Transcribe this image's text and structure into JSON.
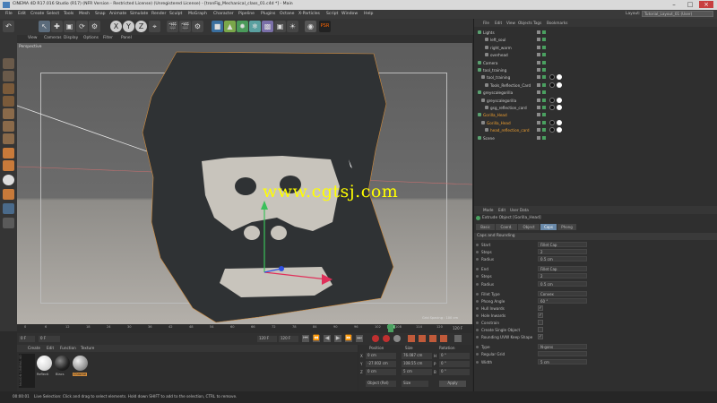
{
  "title": "CINEMA 4D R17.016 Studio (R17) (NFR Version - Restricted License) (Unregistered License) - [tronFig_Mechanical_class_01.c4d *] - Main",
  "menu": [
    "File",
    "Edit",
    "Create",
    "Select",
    "Tools",
    "Mesh",
    "Snap",
    "Animate",
    "Simulate",
    "Render",
    "Sculpt",
    "MoGraph",
    "Character",
    "Pipeline",
    "Plugins",
    "Octane",
    "X-Particles",
    "Script",
    "Window",
    "Help"
  ],
  "layout": {
    "label": "Layout:",
    "value": "Tutorial_Layout_01 (User)"
  },
  "toolbar": {
    "xyz": [
      "X",
      "Y",
      "Z"
    ],
    "tooltip": "Render Settings"
  },
  "viewport": {
    "menu": [
      "View",
      "Cameras",
      "Display",
      "Options",
      "Filter",
      "Panel"
    ],
    "label": "Perspective",
    "watermark": "www.cgtsj.com",
    "grid_spacing": "Grid Spacing : 100 cm"
  },
  "timeline": {
    "ticks": [
      "0",
      "6",
      "12",
      "18",
      "24",
      "30",
      "36",
      "42",
      "48",
      "54",
      "60",
      "66",
      "72",
      "78",
      "84",
      "90",
      "96",
      "102",
      "108",
      "114",
      "120"
    ],
    "current": "104",
    "current_right": "120 F",
    "start": "0 F",
    "frame": "0 F",
    "end": "120 F",
    "end2": "120 F"
  },
  "materials": {
    "menu": [
      "Create",
      "Edit",
      "Function",
      "Texture"
    ],
    "items": [
      "Reflecti",
      "Blacs",
      "Chrome"
    ],
    "brand": "MAXON CINEMA 4D"
  },
  "coords": {
    "headers": [
      "Position",
      "Size",
      "Rotation"
    ],
    "rows": [
      {
        "axis": "X",
        "pos": "0 cm",
        "size": "76.087 cm",
        "rot_axis": "H",
        "rot": "0 °"
      },
      {
        "axis": "Y",
        "pos": "-27.002 cm",
        "size": "108.55 cm",
        "rot_axis": "P",
        "rot": "0 °"
      },
      {
        "axis": "Z",
        "pos": "0 cm",
        "size": "5 cm",
        "rot_axis": "B",
        "rot": "0 °"
      }
    ],
    "mode1": "Object (Rel)",
    "mode2": "Size",
    "apply": "Apply"
  },
  "status": {
    "time": "00:00:01",
    "text": "Live Selection: Click and drag to select elements. Hold down SHIFT to add to the selection, CTRL to remove."
  },
  "objmgr": {
    "menu": [
      "File",
      "Edit",
      "View",
      "Objects",
      "Tags",
      "Bookmarks"
    ],
    "rows": [
      {
        "name": "Lights",
        "indent": 0,
        "color": "#cfcfcf"
      },
      {
        "name": "left_soul",
        "indent": 2,
        "color": "#cfcfcf"
      },
      {
        "name": "right_warm",
        "indent": 2,
        "color": "#cfcfcf"
      },
      {
        "name": "overhead",
        "indent": 2,
        "color": "#cfcfcf"
      },
      {
        "name": "Camera",
        "indent": 0,
        "color": "#cfcfcf"
      },
      {
        "name": "tool_training",
        "indent": 0,
        "color": "#cfcfcf"
      },
      {
        "name": "tool_training",
        "indent": 1,
        "color": "#cfcfcf"
      },
      {
        "name": "Tools_Reflection_Card",
        "indent": 2,
        "color": "#cfcfcf"
      },
      {
        "name": "greyscalegorilla",
        "indent": 0,
        "color": "#cfcfcf"
      },
      {
        "name": "greyscalegorilla",
        "indent": 1,
        "color": "#cfcfcf"
      },
      {
        "name": "gsg_reflection_card",
        "indent": 2,
        "color": "#cfcfcf"
      },
      {
        "name": "Gorilla_Head",
        "indent": 0,
        "color": "#f0a030"
      },
      {
        "name": "Gorilla_Head",
        "indent": 1,
        "color": "#f0a030"
      },
      {
        "name": "head_reflection_card",
        "indent": 2,
        "color": "#f0a030"
      },
      {
        "name": "Scene",
        "indent": 0,
        "color": "#cfcfcf"
      }
    ]
  },
  "attrmgr": {
    "menu": [
      "Mode",
      "Edit",
      "User Data"
    ],
    "object": "Extrude Object [Gorilla_Head]",
    "tabs": [
      "Basic",
      "Coord.",
      "Object",
      "Caps",
      "Phong"
    ],
    "active_tab": "Caps",
    "section": "Caps and Rounding",
    "rows": [
      {
        "label": "Start",
        "value": "Fillet Cap"
      },
      {
        "label": "Steps",
        "value": "2"
      },
      {
        "label": "Radius",
        "value": "0.5 cm"
      },
      {
        "label": "End",
        "value": "Fillet Cap"
      },
      {
        "label": "Steps",
        "value": "2"
      },
      {
        "label": "Radius",
        "value": "0.5 cm"
      },
      {
        "label": "Fillet Type",
        "value": "Convex"
      },
      {
        "label": "Phong Angle",
        "value": "60 °"
      },
      {
        "label": "Hull Inwards",
        "value": "✓"
      },
      {
        "label": "Hole Inwards",
        "value": "✓"
      },
      {
        "label": "Constrain",
        "value": ""
      },
      {
        "label": "Create Single Object",
        "value": ""
      },
      {
        "label": "Rounding UVW Keep Shape",
        "value": "✓"
      },
      {
        "label": "Type",
        "value": "N-gons"
      },
      {
        "label": "Regular Grid",
        "value": ""
      },
      {
        "label": "Width",
        "value": "5 cm"
      }
    ]
  }
}
